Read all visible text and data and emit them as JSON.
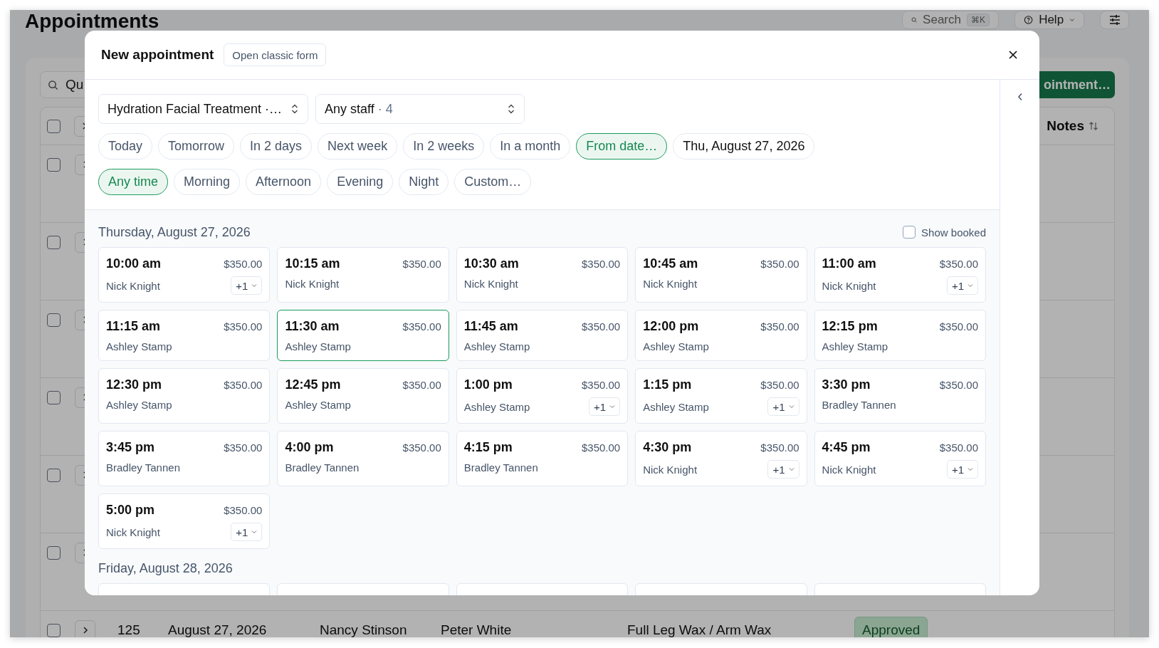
{
  "page": {
    "title": "Appointments",
    "search_button": {
      "label": "Search",
      "shortcut": "⌘K"
    },
    "help_button": "Help",
    "search_field": {
      "placeholder": "Qu"
    },
    "new_button": "ointment…",
    "table": {
      "select_all_checked": false,
      "notes_column": "Notes",
      "rows": [
        {
          "checked": false
        },
        {
          "checked": false
        },
        {
          "checked": false
        },
        {
          "checked": false
        },
        {
          "checked": false
        },
        {
          "checked": false
        },
        {
          "checked": false,
          "id": "125",
          "date": "August 27, 2026",
          "client": "Nancy Stinson",
          "staff": "Peter White",
          "service": "Full Leg Wax / Arm Wax",
          "status": "Approved"
        }
      ]
    }
  },
  "modal": {
    "title": "New appointment",
    "classic_form_button": "Open classic form",
    "service_select": {
      "value": "Hydration Facial Treatment ·…"
    },
    "staff_select": {
      "value": "Any staff",
      "count": "· 4"
    },
    "date_presets": [
      {
        "label": "Today",
        "selected": false
      },
      {
        "label": "Tomorrow",
        "selected": false
      },
      {
        "label": "In 2 days",
        "selected": false
      },
      {
        "label": "Next week",
        "selected": false
      },
      {
        "label": "In 2 weeks",
        "selected": false
      },
      {
        "label": "In a month",
        "selected": false
      },
      {
        "label": "From date…",
        "selected": true
      }
    ],
    "date_value": "Thu, August 27, 2026",
    "time_presets": [
      {
        "label": "Any time",
        "selected": true
      },
      {
        "label": "Morning",
        "selected": false
      },
      {
        "label": "Afternoon",
        "selected": false
      },
      {
        "label": "Evening",
        "selected": false
      },
      {
        "label": "Night",
        "selected": false
      },
      {
        "label": "Custom…",
        "selected": false
      }
    ],
    "show_booked": {
      "label": "Show booked",
      "checked": false
    },
    "days": [
      {
        "heading": "Thursday, August 27, 2026",
        "slots": [
          {
            "time": "10:00 am",
            "price": "$350.00",
            "staff": "Nick Knight",
            "extra": "+1",
            "selected": false
          },
          {
            "time": "10:15 am",
            "price": "$350.00",
            "staff": "Nick Knight",
            "selected": false
          },
          {
            "time": "10:30 am",
            "price": "$350.00",
            "staff": "Nick Knight",
            "selected": false
          },
          {
            "time": "10:45 am",
            "price": "$350.00",
            "staff": "Nick Knight",
            "selected": false
          },
          {
            "time": "11:00 am",
            "price": "$350.00",
            "staff": "Nick Knight",
            "extra": "+1",
            "selected": false
          },
          {
            "time": "11:15 am",
            "price": "$350.00",
            "staff": "Ashley Stamp",
            "selected": false
          },
          {
            "time": "11:30 am",
            "price": "$350.00",
            "staff": "Ashley Stamp",
            "selected": true
          },
          {
            "time": "11:45 am",
            "price": "$350.00",
            "staff": "Ashley Stamp",
            "selected": false
          },
          {
            "time": "12:00 pm",
            "price": "$350.00",
            "staff": "Ashley Stamp",
            "selected": false
          },
          {
            "time": "12:15 pm",
            "price": "$350.00",
            "staff": "Ashley Stamp",
            "selected": false
          },
          {
            "time": "12:30 pm",
            "price": "$350.00",
            "staff": "Ashley Stamp",
            "selected": false
          },
          {
            "time": "12:45 pm",
            "price": "$350.00",
            "staff": "Ashley Stamp",
            "selected": false
          },
          {
            "time": "1:00 pm",
            "price": "$350.00",
            "staff": "Ashley Stamp",
            "extra": "+1",
            "selected": false
          },
          {
            "time": "1:15 pm",
            "price": "$350.00",
            "staff": "Ashley Stamp",
            "extra": "+1",
            "selected": false
          },
          {
            "time": "3:30 pm",
            "price": "$350.00",
            "staff": "Bradley Tannen",
            "selected": false
          },
          {
            "time": "3:45 pm",
            "price": "$350.00",
            "staff": "Bradley Tannen",
            "selected": false
          },
          {
            "time": "4:00 pm",
            "price": "$350.00",
            "staff": "Bradley Tannen",
            "selected": false
          },
          {
            "time": "4:15 pm",
            "price": "$350.00",
            "staff": "Bradley Tannen",
            "selected": false
          },
          {
            "time": "4:30 pm",
            "price": "$350.00",
            "staff": "Nick Knight",
            "extra": "+1",
            "selected": false
          },
          {
            "time": "4:45 pm",
            "price": "$350.00",
            "staff": "Nick Knight",
            "extra": "+1",
            "selected": false
          },
          {
            "time": "5:00 pm",
            "price": "$350.00",
            "staff": "Nick Knight",
            "extra": "+1",
            "selected": false
          }
        ]
      },
      {
        "heading": "Friday, August 28, 2026",
        "slots": [
          {
            "selected": false
          },
          {
            "selected": false
          },
          {
            "selected": false
          },
          {
            "selected": false
          },
          {
            "selected": false
          }
        ]
      }
    ]
  }
}
